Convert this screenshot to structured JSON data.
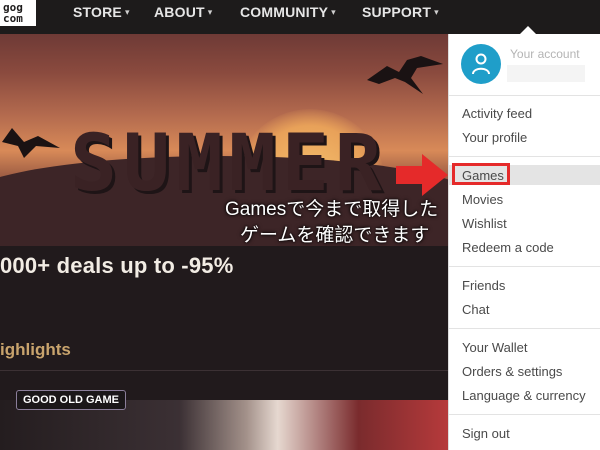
{
  "brand": {
    "logo_line1": "gog",
    "logo_line2": "com"
  },
  "nav": {
    "items": [
      {
        "label": "STORE",
        "chevron": "▾"
      },
      {
        "label": "ABOUT",
        "chevron": "▾"
      },
      {
        "label": "COMMUNITY",
        "chevron": "▾"
      },
      {
        "label": "SUPPORT",
        "chevron": "▾"
      }
    ]
  },
  "hero": {
    "banner_text": "SUMMER",
    "deals_text": "000+ deals up to -95%"
  },
  "annotation": {
    "caption_line1": "Gamesで今まで取得した",
    "caption_line2": "ゲームを確認できます",
    "arrow_color": "#e52a2a"
  },
  "section": {
    "highlights_label": "ighlights",
    "badge_label": "GOOD OLD GAME"
  },
  "account_menu": {
    "header_label": "Your account",
    "items": [
      "Activity feed",
      "Your profile",
      "Games",
      "Movies",
      "Wishlist",
      "Redeem a code",
      "Friends",
      "Chat",
      "Your Wallet",
      "Orders & settings",
      "Language & currency",
      "Sign out"
    ],
    "highlighted_item": "Games"
  },
  "colors": {
    "nav_bg": "#1d1b1b",
    "avatar": "#1f9ec9",
    "highlight_box": "#e52a2a",
    "highlights_text": "#c9a46d"
  },
  "icons": [
    "user-icon",
    "chevron-down-icon",
    "bird-icon",
    "arrow-right-icon"
  ]
}
